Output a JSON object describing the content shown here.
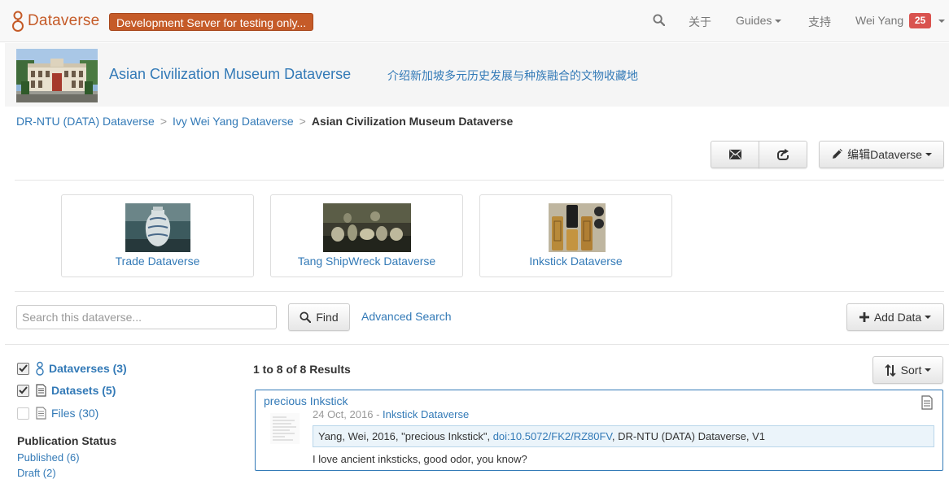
{
  "navbar": {
    "brand": "Dataverse",
    "dev_badge": "Development Server for testing only...",
    "about": "关于",
    "guides": "Guides",
    "support": "支持",
    "user": "Wei Yang",
    "notifications": "25"
  },
  "header": {
    "name": "Asian Civilization Museum Dataverse",
    "tagline": "介绍新加坡多元历史发展与种族融合的文物收藏地"
  },
  "breadcrumb": {
    "items": [
      "DR-NTU (DATA) Dataverse",
      "Ivy Wei Yang Dataverse"
    ],
    "separator": ">",
    "current": "Asian Civilization Museum Dataverse"
  },
  "toolbar": {
    "edit_label": "编辑Dataverse"
  },
  "featured": [
    {
      "label": "Trade Dataverse"
    },
    {
      "label": "Tang ShipWreck Dataverse"
    },
    {
      "label": "Inkstick Dataverse"
    }
  ],
  "search": {
    "placeholder": "Search this dataverse...",
    "find_label": "Find",
    "advanced_label": "Advanced Search",
    "add_data_label": "Add Data"
  },
  "facets": {
    "dataverses": "Dataverses (3)",
    "datasets": "Datasets (5)",
    "files": "Files (30)",
    "publication_status_title": "Publication Status",
    "published": "Published (6)",
    "draft": "Draft (2)"
  },
  "results": {
    "count_text": "1 to 8 of 8 Results",
    "sort_label": "Sort",
    "items": [
      {
        "title": "precious Inkstick",
        "date": "24 Oct, 2016",
        "date_sep": " - ",
        "parent": "Inkstick Dataverse",
        "citation_prefix": "Yang, Wei, 2016, \"precious Inkstick\", ",
        "doi": "doi:10.5072/FK2/RZ80FV",
        "citation_suffix": ", DR-NTU (DATA) Dataverse, V1",
        "description": "I love ancient inksticks, good odor, you know?"
      }
    ]
  },
  "colors": {
    "brand": "#c55b28",
    "link": "#337ab7",
    "badge": "#d9534f",
    "citation_bg": "#ebf4fa"
  }
}
